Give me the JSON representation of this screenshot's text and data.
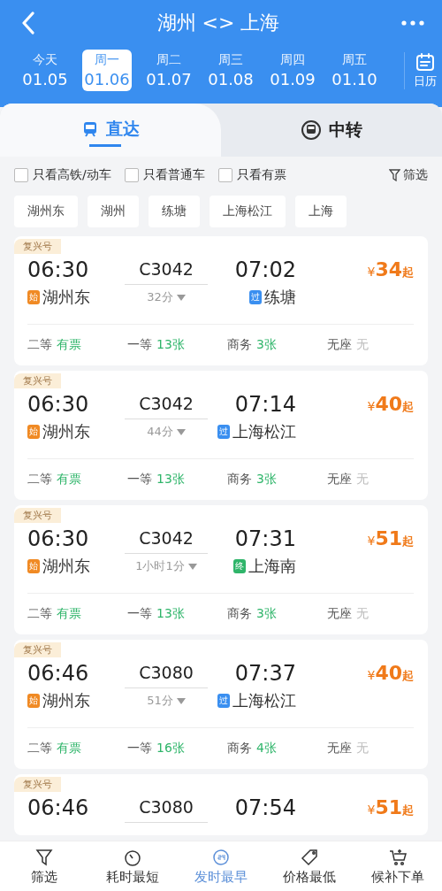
{
  "nav": {
    "title": "湖州 <> 上海"
  },
  "dates": [
    {
      "weekday": "今天",
      "date": "01.05",
      "selected": false
    },
    {
      "weekday": "周一",
      "date": "01.06",
      "selected": true
    },
    {
      "weekday": "周二",
      "date": "01.07",
      "selected": false
    },
    {
      "weekday": "周三",
      "date": "01.08",
      "selected": false
    },
    {
      "weekday": "周四",
      "date": "01.09",
      "selected": false
    },
    {
      "weekday": "周五",
      "date": "01.10",
      "selected": false
    }
  ],
  "calendar": {
    "label": "日历"
  },
  "tabs": [
    {
      "label": "直达",
      "kind": "direct",
      "selected": true
    },
    {
      "label": "中转",
      "kind": "transfer",
      "selected": false
    }
  ],
  "filters": [
    {
      "label": "只看高铁/动车",
      "checked": false
    },
    {
      "label": "只看普通车",
      "checked": false
    },
    {
      "label": "只看有票",
      "checked": false
    }
  ],
  "filter_button": {
    "label": "筛选"
  },
  "stations": [
    "湖州东",
    "湖州",
    "练塘",
    "上海松江",
    "上海"
  ],
  "trains": [
    {
      "tag": "复兴号",
      "depart": "06:30",
      "number": "C3042",
      "arrive": "07:02",
      "currency": "¥",
      "amount": "34",
      "suffix": "起",
      "from_badge": {
        "kind": "start",
        "text": "始"
      },
      "from": "湖州东",
      "duration": "32分",
      "to_badge": {
        "kind": "pass",
        "text": "过"
      },
      "to": "练塘",
      "seats": [
        {
          "label": "二等",
          "value": "有票",
          "available": true
        },
        {
          "label": "一等",
          "value": "13张",
          "available": true
        },
        {
          "label": "商务",
          "value": "3张",
          "available": true
        },
        {
          "label": "无座",
          "value": "无",
          "available": false
        }
      ]
    },
    {
      "tag": "复兴号",
      "depart": "06:30",
      "number": "C3042",
      "arrive": "07:14",
      "currency": "¥",
      "amount": "40",
      "suffix": "起",
      "from_badge": {
        "kind": "start",
        "text": "始"
      },
      "from": "湖州东",
      "duration": "44分",
      "to_badge": {
        "kind": "pass",
        "text": "过"
      },
      "to": "上海松江",
      "seats": [
        {
          "label": "二等",
          "value": "有票",
          "available": true
        },
        {
          "label": "一等",
          "value": "13张",
          "available": true
        },
        {
          "label": "商务",
          "value": "3张",
          "available": true
        },
        {
          "label": "无座",
          "value": "无",
          "available": false
        }
      ]
    },
    {
      "tag": "复兴号",
      "depart": "06:30",
      "number": "C3042",
      "arrive": "07:31",
      "currency": "¥",
      "amount": "51",
      "suffix": "起",
      "from_badge": {
        "kind": "start",
        "text": "始"
      },
      "from": "湖州东",
      "duration": "1小时1分",
      "to_badge": {
        "kind": "end",
        "text": "终"
      },
      "to": "上海南",
      "seats": [
        {
          "label": "二等",
          "value": "有票",
          "available": true
        },
        {
          "label": "一等",
          "value": "13张",
          "available": true
        },
        {
          "label": "商务",
          "value": "3张",
          "available": true
        },
        {
          "label": "无座",
          "value": "无",
          "available": false
        }
      ]
    },
    {
      "tag": "复兴号",
      "depart": "06:46",
      "number": "C3080",
      "arrive": "07:37",
      "currency": "¥",
      "amount": "40",
      "suffix": "起",
      "from_badge": {
        "kind": "start",
        "text": "始"
      },
      "from": "湖州东",
      "duration": "51分",
      "to_badge": {
        "kind": "pass",
        "text": "过"
      },
      "to": "上海松江",
      "seats": [
        {
          "label": "二等",
          "value": "有票",
          "available": true
        },
        {
          "label": "一等",
          "value": "16张",
          "available": true
        },
        {
          "label": "商务",
          "value": "4张",
          "available": true
        },
        {
          "label": "无座",
          "value": "无",
          "available": false
        }
      ]
    },
    {
      "tag": "复兴号",
      "depart": "06:46",
      "number": "C3080",
      "arrive": "07:54",
      "currency": "¥",
      "amount": "51",
      "suffix": "起"
    }
  ],
  "sort_bar": [
    {
      "label": "筛选",
      "kind": "filter",
      "selected": false
    },
    {
      "label": "耗时最短",
      "kind": "duration",
      "selected": false
    },
    {
      "label": "发时最早",
      "kind": "earliest",
      "selected": true
    },
    {
      "label": "价格最低",
      "kind": "price",
      "selected": false
    },
    {
      "label": "候补下单",
      "kind": "waitlist",
      "selected": false
    }
  ]
}
